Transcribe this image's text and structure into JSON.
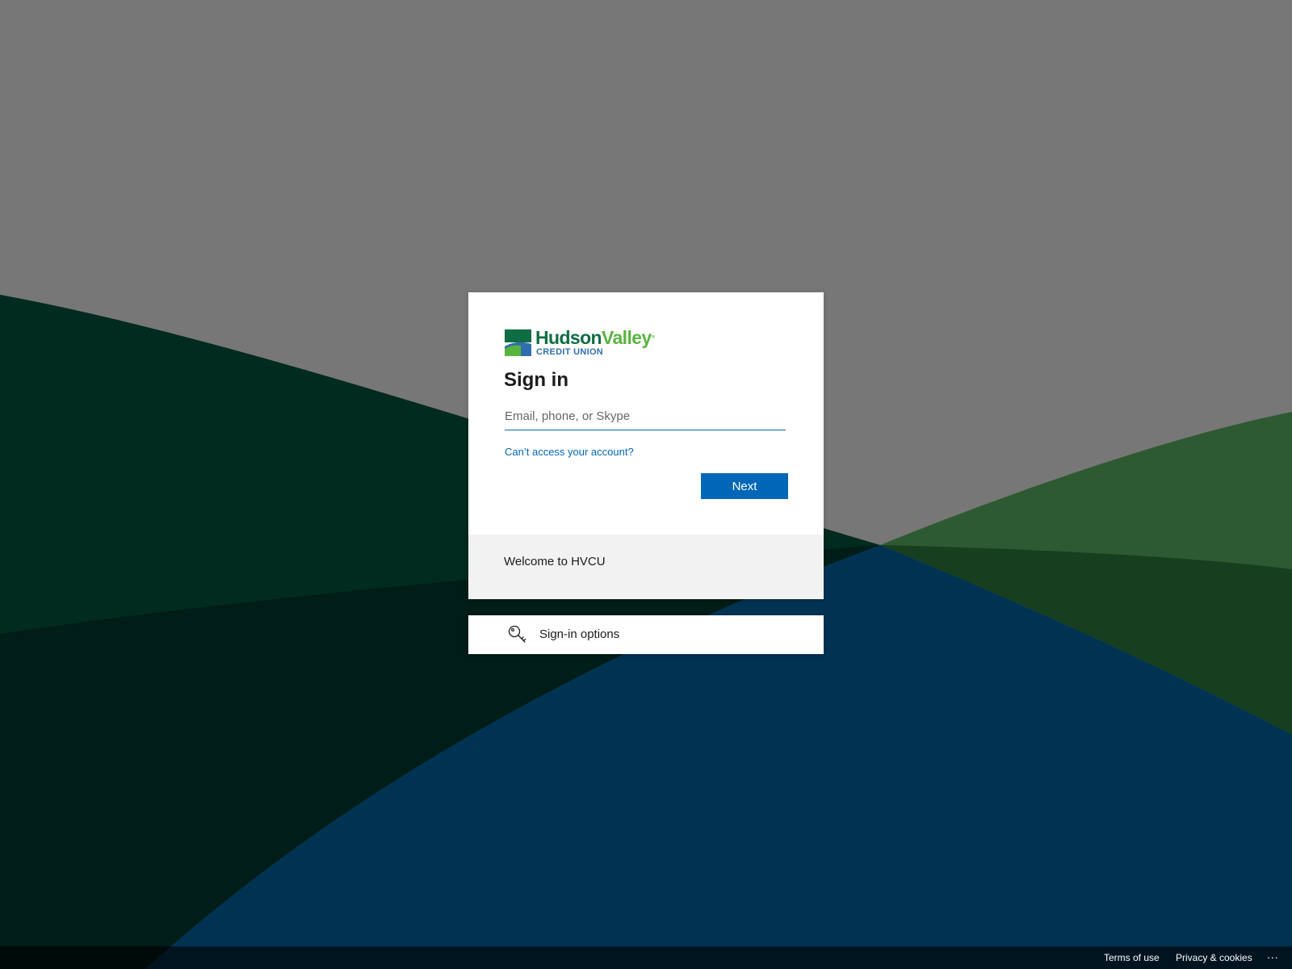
{
  "brand": {
    "name_part1": "Hudson",
    "name_part2": "Valley",
    "sub": "CREDIT UNION",
    "colors": {
      "dark_green": "#0f6d43",
      "light_green": "#59b43f",
      "blue": "#2f6fb1"
    }
  },
  "signin": {
    "title": "Sign in",
    "input_placeholder": "Email, phone, or Skype",
    "input_value": "",
    "cant_access_link": "Can’t access your account?",
    "next_button": "Next",
    "welcome_text": "Welcome to HVCU"
  },
  "options": {
    "label": "Sign-in options",
    "icon": "key-icon"
  },
  "footer": {
    "terms": "Terms of use",
    "privacy": "Privacy & cookies",
    "more": "..."
  },
  "theme": {
    "accent": "#0067b8",
    "welcome_bg": "#f2f2f2"
  }
}
